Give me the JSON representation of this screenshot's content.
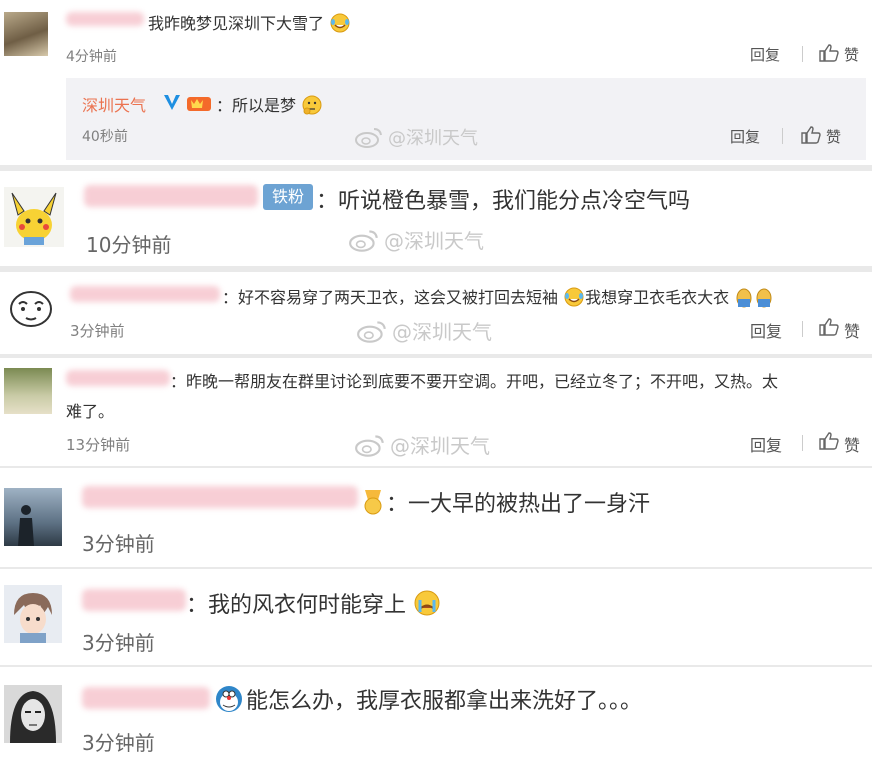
{
  "actions": {
    "reply": "回复",
    "like": "赞"
  },
  "watermark": "@深圳天气",
  "comments": [
    {
      "text": "我昨晚梦见深圳下大雪了",
      "time": "4分钟前",
      "reply": {
        "author": "深圳天气",
        "text": "：所以是梦",
        "time": "40秒前"
      }
    },
    {
      "badge": "铁粉",
      "text": "：听说橙色暴雪，我们能分点冷空气吗",
      "time": "10分钟前"
    },
    {
      "text": "：好不容易穿了两天卫衣，这会又被打回去短袖",
      "text2": "我想穿卫衣毛衣大衣",
      "time": "3分钟前"
    },
    {
      "text": "：昨晚一帮朋友在群里讨论到底要不要开空调。开吧，已经立冬了；不开吧，又热。太",
      "text_line2": "难了。",
      "time": "13分钟前"
    },
    {
      "text": "：一大早的被热出了一身汗",
      "time": "3分钟前"
    },
    {
      "text": "：我的风衣何时能穿上",
      "time": "3分钟前"
    },
    {
      "text": "能怎么办，我厚衣服都拿出来洗好了。。。",
      "time": "3分钟前"
    }
  ],
  "colors": {
    "name": "#eb7350",
    "time": "#808080",
    "separator": "#e9e9e9",
    "badge": "#6da3d3"
  }
}
